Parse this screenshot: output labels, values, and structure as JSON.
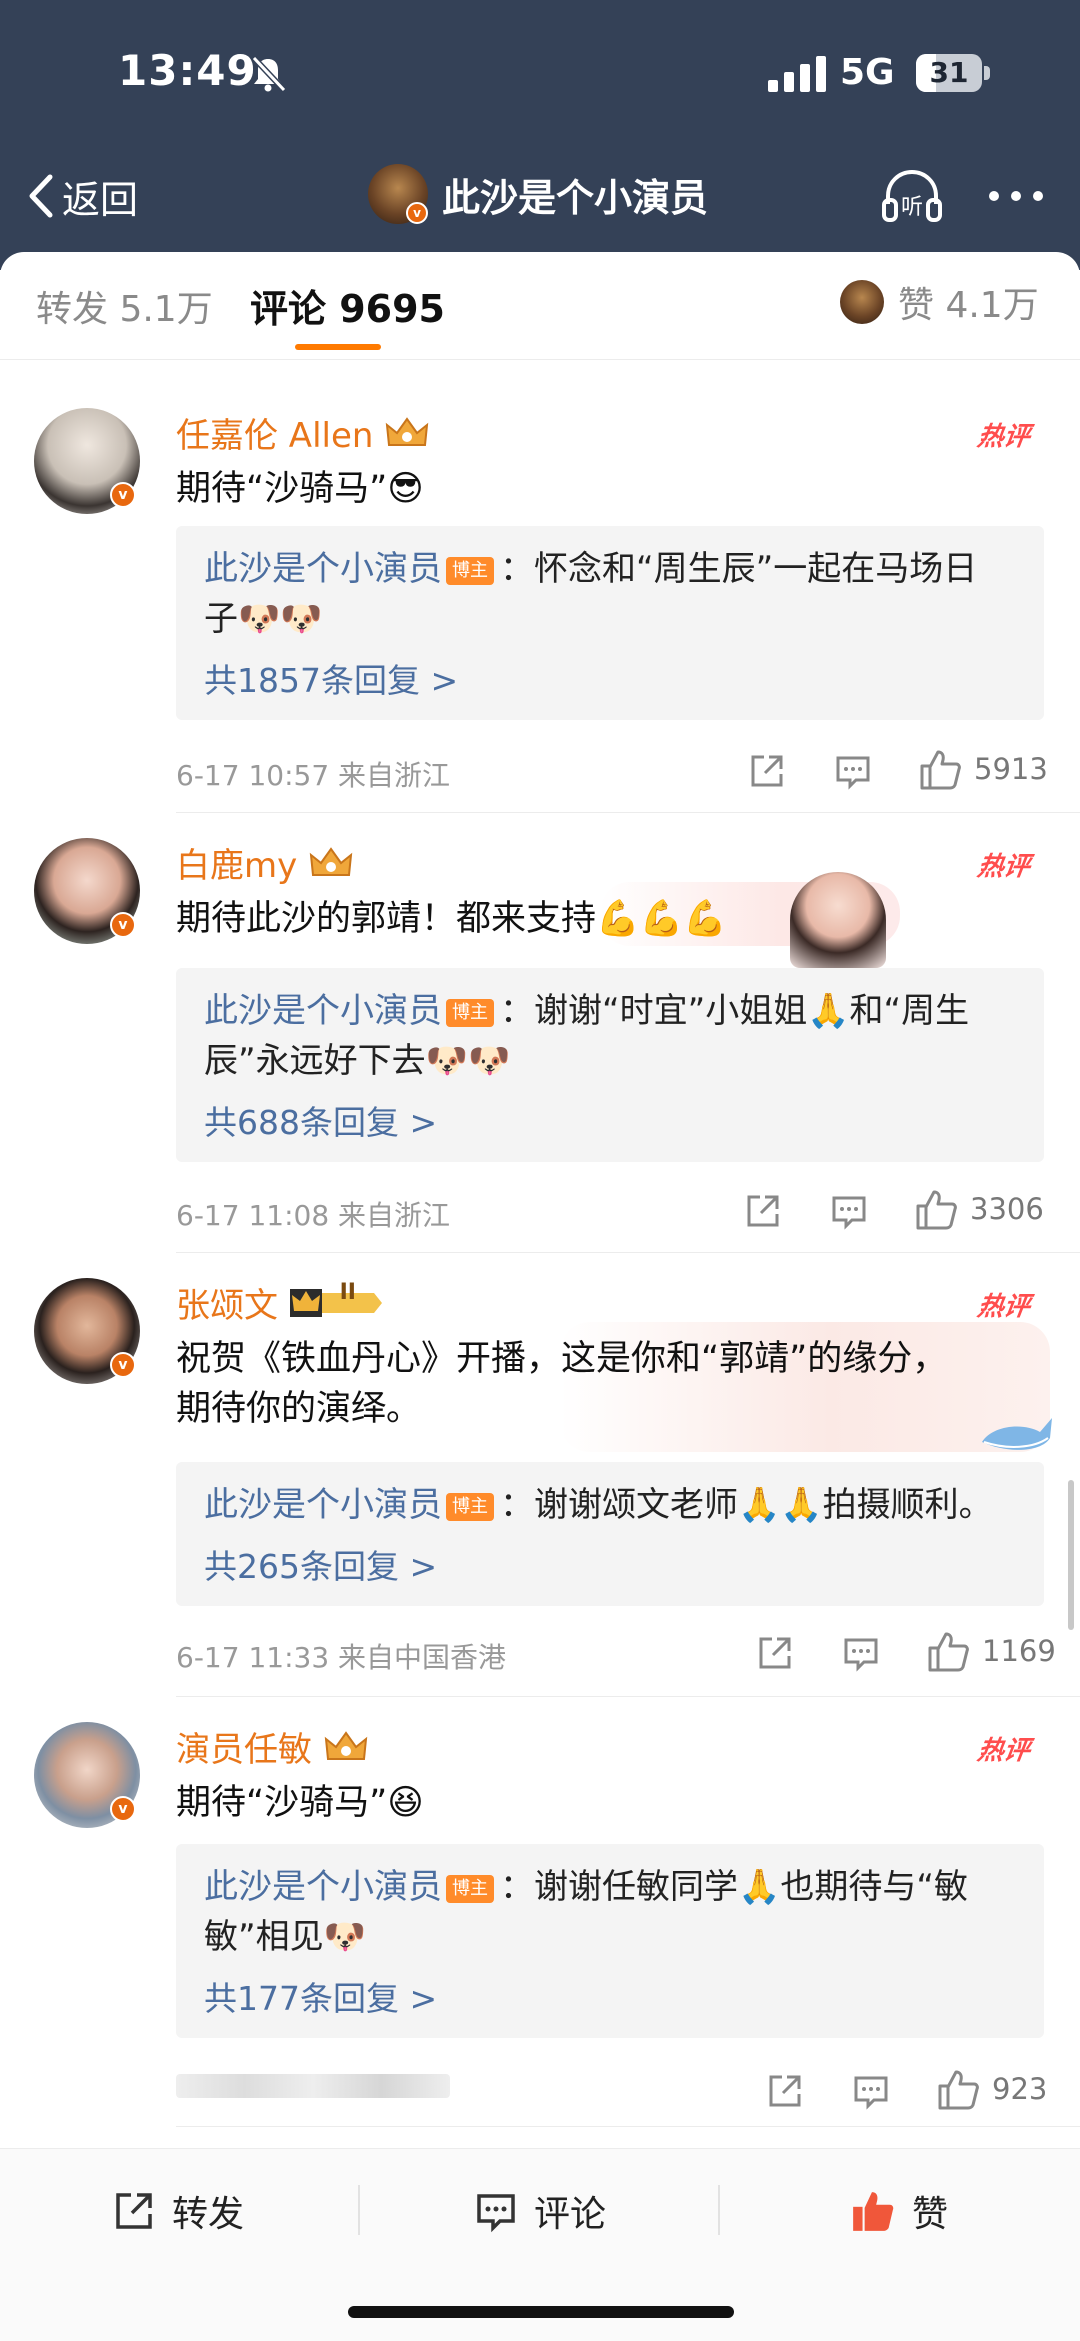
{
  "status_bar": {
    "time": "13:49",
    "network": "5G",
    "battery": "31",
    "battery_level": 0.31
  },
  "nav": {
    "back_label": "返回",
    "title": "此沙是个小演员",
    "listen_label": "听"
  },
  "tabs": {
    "repost": "转发 5.1万",
    "comment": "评论 9695",
    "likes": "赞 4.1万"
  },
  "comments": [
    {
      "name": "任嘉伦 Allen",
      "hot": "热评",
      "text": "期待“沙骑马”😎",
      "reply_author": "此沙是个小演员",
      "bozhu": "博主",
      "reply_line1": "：怀念和“周生辰”一起在马场日",
      "reply_line2": "子🐶🐶",
      "reply_count": "共1857条回复 >",
      "meta": "6-17 10:57  来自浙江",
      "likes": "5913"
    },
    {
      "name": "白鹿my",
      "hot": "热评",
      "text": "期待此沙的郭靖！都来支持💪💪💪",
      "reply_author": "此沙是个小演员",
      "bozhu": "博主",
      "reply_line1": "：谢谢“时宜”小姐姐🙏和“周生",
      "reply_line2": "辰”永远好下去🐶🐶",
      "reply_count": "共688条回复 >",
      "meta": "6-17 11:08  来自浙江",
      "likes": "3306"
    },
    {
      "name": "张颂文",
      "hot": "热评",
      "text_line1": "祝贺《铁血丹心》开播，这是你和“郭靖”的缘分，",
      "text_line2": "期待你的演绎。",
      "reply_author": "此沙是个小演员",
      "bozhu": "博主",
      "reply_line1": "：谢谢颂文老师🙏🙏拍摄顺利。",
      "reply_count": "共265条回复 >",
      "meta": "6-17 11:33  来自中国香港",
      "likes": "1169",
      "badge_level": "II"
    },
    {
      "name": "演员任敏",
      "hot": "热评",
      "text": "期待“沙骑马”😆",
      "reply_author": "此沙是个小演员",
      "bozhu": "博主",
      "reply_line1": "：谢谢任敏同学🙏也期待与“敏",
      "reply_line2": "敏”相见🐶",
      "reply_count": "共177条回复 >",
      "likes": "923"
    }
  ],
  "bottom_bar": {
    "repost": "转发",
    "comment": "评论",
    "like": "赞"
  },
  "colors": {
    "header_bg": "#344157",
    "accent": "#ff7a00",
    "link": "#4b6ea0",
    "name": "#e8761a"
  }
}
